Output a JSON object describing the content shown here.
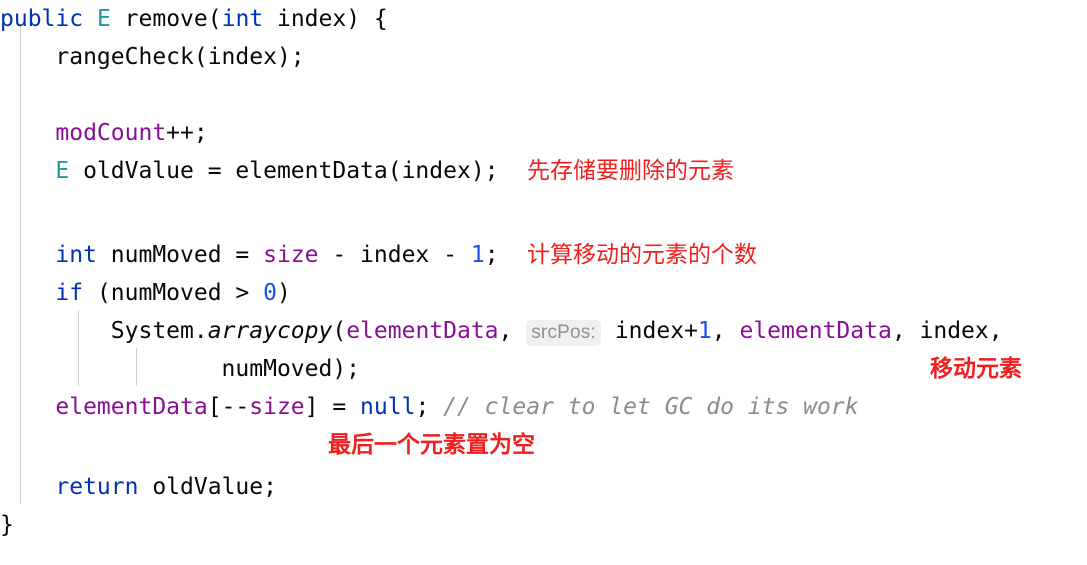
{
  "editor": {
    "background_color": "#ffffff",
    "language": "java",
    "method_name": "remove",
    "font_size_px": 23,
    "colors": {
      "keyword": "#0033b3",
      "type": "#20999d",
      "field": "#871094",
      "number": "#1750eb",
      "comment": "#8c8c8c",
      "plain_text": "#080808",
      "annotation_red": "#f02020",
      "hint_background": "#f0f0f0",
      "hint_text": "#909090",
      "indent_guide": "#d0d0d0"
    }
  },
  "code_lines": [
    {
      "id": "line-signature",
      "tokens": [
        {
          "text": "public",
          "kind": "keyword"
        },
        {
          "text": " ",
          "kind": "plain"
        },
        {
          "text": "E",
          "kind": "type"
        },
        {
          "text": " remove(",
          "kind": "plain"
        },
        {
          "text": "int",
          "kind": "keyword"
        },
        {
          "text": " index) {",
          "kind": "plain"
        }
      ]
    },
    {
      "id": "line-rangecheck",
      "tokens": [
        {
          "text": "    rangeCheck(index);",
          "kind": "plain"
        }
      ]
    },
    {
      "id": "line-blank-1",
      "tokens": [
        {
          "text": "",
          "kind": "plain"
        }
      ]
    },
    {
      "id": "line-modcount",
      "tokens": [
        {
          "text": "    ",
          "kind": "plain"
        },
        {
          "text": "modCount",
          "kind": "field"
        },
        {
          "text": "++;",
          "kind": "plain"
        }
      ]
    },
    {
      "id": "line-oldvalue",
      "tokens": [
        {
          "text": "    ",
          "kind": "plain"
        },
        {
          "text": "E",
          "kind": "type"
        },
        {
          "text": " oldValue = elementData(index);",
          "kind": "plain"
        }
      ]
    },
    {
      "id": "line-blank-2",
      "tokens": [
        {
          "text": "",
          "kind": "plain"
        }
      ]
    },
    {
      "id": "line-nummoved",
      "tokens": [
        {
          "text": "    ",
          "kind": "plain"
        },
        {
          "text": "int",
          "kind": "keyword"
        },
        {
          "text": " numMoved = ",
          "kind": "plain"
        },
        {
          "text": "size",
          "kind": "field"
        },
        {
          "text": " - index - ",
          "kind": "plain"
        },
        {
          "text": "1",
          "kind": "number"
        },
        {
          "text": ";",
          "kind": "plain"
        }
      ]
    },
    {
      "id": "line-if",
      "tokens": [
        {
          "text": "    ",
          "kind": "plain"
        },
        {
          "text": "if",
          "kind": "keyword"
        },
        {
          "text": " (numMoved > ",
          "kind": "plain"
        },
        {
          "text": "0",
          "kind": "number"
        },
        {
          "text": ")",
          "kind": "plain"
        }
      ]
    },
    {
      "id": "line-arraycopy",
      "tokens": [
        {
          "text": "        System.",
          "kind": "plain"
        },
        {
          "text": "arraycopy",
          "kind": "static-method"
        },
        {
          "text": "(",
          "kind": "plain"
        },
        {
          "text": "elementData",
          "kind": "field"
        },
        {
          "text": ", ",
          "kind": "plain"
        },
        {
          "text": "srcPos:",
          "kind": "param-hint"
        },
        {
          "text": " index+",
          "kind": "plain"
        },
        {
          "text": "1",
          "kind": "number"
        },
        {
          "text": ", ",
          "kind": "plain"
        },
        {
          "text": "elementData",
          "kind": "field"
        },
        {
          "text": ", index,",
          "kind": "plain"
        }
      ]
    },
    {
      "id": "line-arraycopy-cont",
      "tokens": [
        {
          "text": "                numMoved);",
          "kind": "plain"
        }
      ]
    },
    {
      "id": "line-null-assign",
      "tokens": [
        {
          "text": "    ",
          "kind": "plain"
        },
        {
          "text": "elementData",
          "kind": "field"
        },
        {
          "text": "[--",
          "kind": "plain"
        },
        {
          "text": "size",
          "kind": "field"
        },
        {
          "text": "] = ",
          "kind": "plain"
        },
        {
          "text": "null",
          "kind": "keyword"
        },
        {
          "text": "; ",
          "kind": "plain"
        },
        {
          "text": "// clear to let GC do its work",
          "kind": "comment"
        }
      ]
    },
    {
      "id": "line-blank-3",
      "tokens": [
        {
          "text": "",
          "kind": "plain"
        }
      ]
    },
    {
      "id": "line-return",
      "tokens": [
        {
          "text": "    ",
          "kind": "plain"
        },
        {
          "text": "return",
          "kind": "keyword"
        },
        {
          "text": " oldValue;",
          "kind": "plain"
        }
      ]
    },
    {
      "id": "line-close-brace",
      "tokens": [
        {
          "text": "}",
          "kind": "plain"
        }
      ]
    }
  ],
  "annotations": [
    {
      "id": "anno-store-element",
      "text": "先存储要删除的元素",
      "bold": false
    },
    {
      "id": "anno-count-moved",
      "text": "计算移动的元素的个数",
      "bold": false
    },
    {
      "id": "anno-move-element",
      "text": "移动元素",
      "bold": true
    },
    {
      "id": "anno-last-null",
      "text": "最后一个元素置为空",
      "bold": true
    }
  ],
  "param_hints": [
    {
      "id": "hint-srcpos",
      "label": "srcPos:"
    }
  ]
}
